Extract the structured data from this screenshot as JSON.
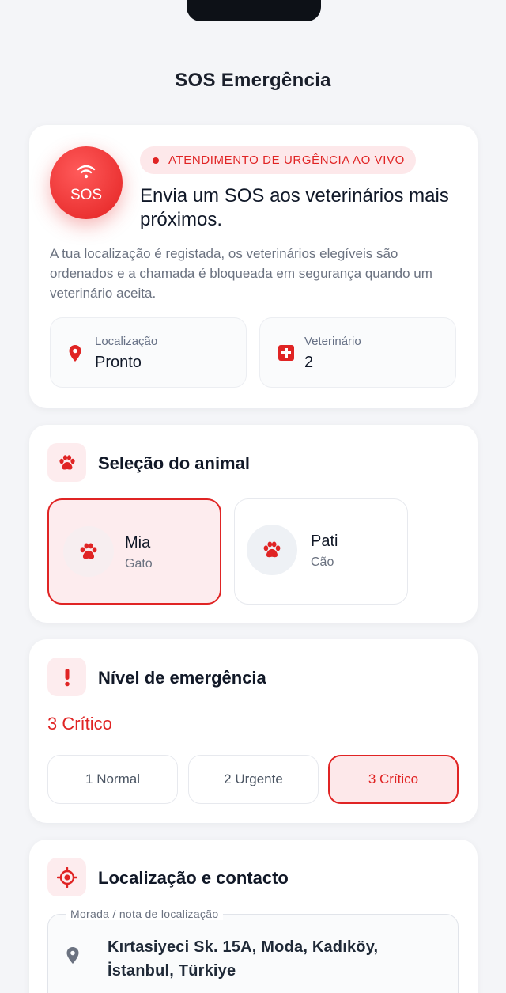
{
  "header": {
    "title": "SOS Emergência"
  },
  "sos": {
    "button_label": "SOS",
    "badge": "ATENDIMENTO DE URGÊNCIA AO VIVO",
    "headline": "Envia um SOS aos veterinários mais próximos.",
    "description": "A tua localização é registada, os veterinários elegíveis são ordenados e a chamada é bloqueada em segurança quando um veterinário aceita.",
    "stats": {
      "location": {
        "label": "Localização",
        "value": "Pronto"
      },
      "vet": {
        "label": "Veterinário",
        "value": "2"
      }
    }
  },
  "animal": {
    "title": "Seleção do animal",
    "pets": [
      {
        "name": "Mia",
        "type": "Gato",
        "selected": true
      },
      {
        "name": "Pati",
        "type": "Cão",
        "selected": false
      }
    ]
  },
  "level": {
    "title": "Nível de emergência",
    "current": "3 Crítico",
    "options": [
      "1 Normal",
      "2 Urgente",
      "3 Crítico"
    ]
  },
  "contact": {
    "title": "Localização e contacto",
    "address_label": "Morada / nota de localização",
    "address": "Kırtasiyeci Sk. 15A, Moda, Kadıköy, İstanbul, Türkiye"
  },
  "colors": {
    "accent": "#e02424",
    "accent_soft": "#fde8ea"
  }
}
